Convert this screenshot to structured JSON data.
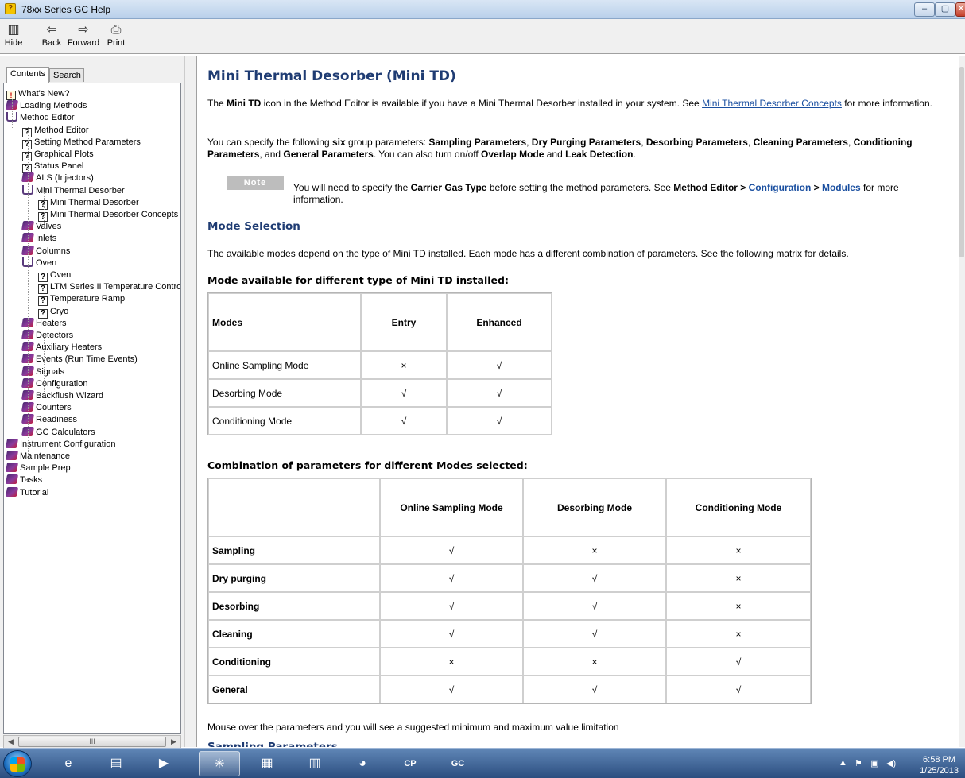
{
  "window": {
    "title": "78xx Series GC Help",
    "app_icon": "help-icon",
    "minimize": "–",
    "maximize": "▢",
    "close": "✕"
  },
  "toolbar": {
    "hide": {
      "label": "Hide",
      "icon": "hide-pane-icon"
    },
    "back": {
      "label": "Back",
      "icon": "arrow-left-icon"
    },
    "forward": {
      "label": "Forward",
      "icon": "arrow-right-icon"
    },
    "print": {
      "label": "Print",
      "icon": "printer-icon"
    }
  },
  "nav": {
    "tabs": [
      "Contents",
      "Search"
    ],
    "tree": [
      {
        "label": "What's New?",
        "icon": "new-page-icon"
      },
      {
        "label": "Loading Methods",
        "icon": "book-icon"
      },
      {
        "label": "Method Editor",
        "icon": "open-book-icon"
      },
      {
        "label": "Method Editor",
        "icon": "help-page-icon"
      },
      {
        "label": "Setting Method Parameters",
        "icon": "help-page-icon"
      },
      {
        "label": "Graphical Plots",
        "icon": "help-page-icon"
      },
      {
        "label": "Status Panel",
        "icon": "help-page-icon"
      },
      {
        "label": "ALS (Injectors)",
        "icon": "book-icon"
      },
      {
        "label": "Mini Thermal Desorber",
        "icon": "open-book-icon"
      },
      {
        "label": "Mini Thermal Desorber",
        "icon": "help-page-icon"
      },
      {
        "label": "Mini Thermal Desorber Concepts",
        "icon": "help-page-icon"
      },
      {
        "label": "Valves",
        "icon": "book-icon"
      },
      {
        "label": "Inlets",
        "icon": "book-icon"
      },
      {
        "label": "Columns",
        "icon": "book-icon"
      },
      {
        "label": "Oven",
        "icon": "open-book-icon"
      },
      {
        "label": "Oven",
        "icon": "help-page-icon"
      },
      {
        "label": "LTM Series II Temperature Contro",
        "icon": "help-page-icon"
      },
      {
        "label": "Temperature Ramp",
        "icon": "help-page-icon"
      },
      {
        "label": "Cryo",
        "icon": "help-page-icon"
      },
      {
        "label": "Heaters",
        "icon": "book-icon"
      },
      {
        "label": "Detectors",
        "icon": "book-icon"
      },
      {
        "label": "Auxiliary Heaters",
        "icon": "book-icon"
      },
      {
        "label": "Events (Run Time Events)",
        "icon": "book-icon"
      },
      {
        "label": "Signals",
        "icon": "book-icon"
      },
      {
        "label": "Configuration",
        "icon": "book-icon"
      },
      {
        "label": "Backflush Wizard",
        "icon": "book-icon"
      },
      {
        "label": "Counters",
        "icon": "book-icon"
      },
      {
        "label": "Readiness",
        "icon": "book-icon"
      },
      {
        "label": "GC Calculators",
        "icon": "book-icon"
      },
      {
        "label": "Instrument Configuration",
        "icon": "book-icon"
      },
      {
        "label": "Maintenance",
        "icon": "book-icon"
      },
      {
        "label": "Sample Prep",
        "icon": "book-icon"
      },
      {
        "label": "Tasks",
        "icon": "book-icon"
      },
      {
        "label": "Tutorial",
        "icon": "book-icon"
      }
    ],
    "hscroll_thumb": "III"
  },
  "content": {
    "title": "Mini Thermal Desorber (Mini TD)",
    "p1": {
      "a": "The ",
      "b1": "Mini TD",
      "c": " icon in the Method Editor is available if you have a Mini Thermal Desorber installed in your system. See ",
      "link": "Mini Thermal Desorber Concepts",
      "d": " for more information."
    },
    "p2": {
      "a": "You can specify the following ",
      "six": "six",
      "b": " group parameters: ",
      "g1": "Sampling Parameters",
      "s1": ", ",
      "g2": "Dry Purging Parameters",
      "s2": ", ",
      "g3": "Desorbing Parameters",
      "s3": ", ",
      "g4": "Cleaning Parameters",
      "s4": ", ",
      "g5": "Conditioning Parameters",
      "s5": ", and ",
      "g6": "General Parameters",
      "c": ". You can also turn on/off ",
      "m1": "Overlap Mode",
      "and": " and ",
      "m2": "Leak Detection",
      "end": "."
    },
    "note": {
      "badge": "Note",
      "a": "You will need to specify the ",
      "b": "Carrier Gas Type",
      "c": " before setting the method parameters. See ",
      "path1": "Method Editor > ",
      "link1": "Configuration",
      "sep": " > ",
      "link2": "Modules",
      "d": " for more information."
    },
    "mode_heading": "Mode Selection",
    "mode_text": "The available modes depend on the type of Mini TD installed. Each mode has a different combination of parameters. See the following matrix for details.",
    "table1": {
      "caption": "Mode available for different type of Mini TD installed:",
      "headers": [
        "Modes",
        "Entry",
        "Enhanced"
      ],
      "rows": [
        [
          "Online Sampling Mode",
          "×",
          "√"
        ],
        [
          "Desorbing Mode",
          "√",
          "√"
        ],
        [
          "Conditioning Mode",
          "√",
          "√"
        ]
      ]
    },
    "table2": {
      "caption": "Combination of parameters for different Modes selected:",
      "headers": [
        "",
        "Online Sampling Mode",
        "Desorbing Mode",
        "Conditioning Mode"
      ],
      "rows": [
        [
          "Sampling",
          "√",
          "×",
          "×"
        ],
        [
          "Dry purging",
          "√",
          "√",
          "×"
        ],
        [
          "Desorbing",
          "√",
          "√",
          "×"
        ],
        [
          "Cleaning",
          "√",
          "√",
          "×"
        ],
        [
          "Conditioning",
          "×",
          "×",
          "√"
        ],
        [
          "General",
          "√",
          "√",
          "√"
        ]
      ]
    },
    "footer": "Mouse over the parameters and you will see a suggested minimum and maximum value limitation",
    "cut_heading": "Sampling Parameters"
  },
  "taskbar": {
    "items": [
      {
        "name": "internet-explorer-icon",
        "glyph": "e"
      },
      {
        "name": "file-explorer-icon",
        "glyph": "▤"
      },
      {
        "name": "media-player-icon",
        "glyph": "▶"
      },
      {
        "name": "network-app-icon",
        "glyph": "✳"
      },
      {
        "name": "control-panel-icon",
        "glyph": "▦"
      },
      {
        "name": "calculator-icon",
        "glyph": "▥"
      },
      {
        "name": "paint-icon",
        "glyph": "◕"
      },
      {
        "name": "cp-app-icon",
        "glyph": "CP"
      },
      {
        "name": "gc-app-icon",
        "glyph": "GC"
      }
    ],
    "time": "6:58 PM",
    "date": "1/25/2013"
  }
}
